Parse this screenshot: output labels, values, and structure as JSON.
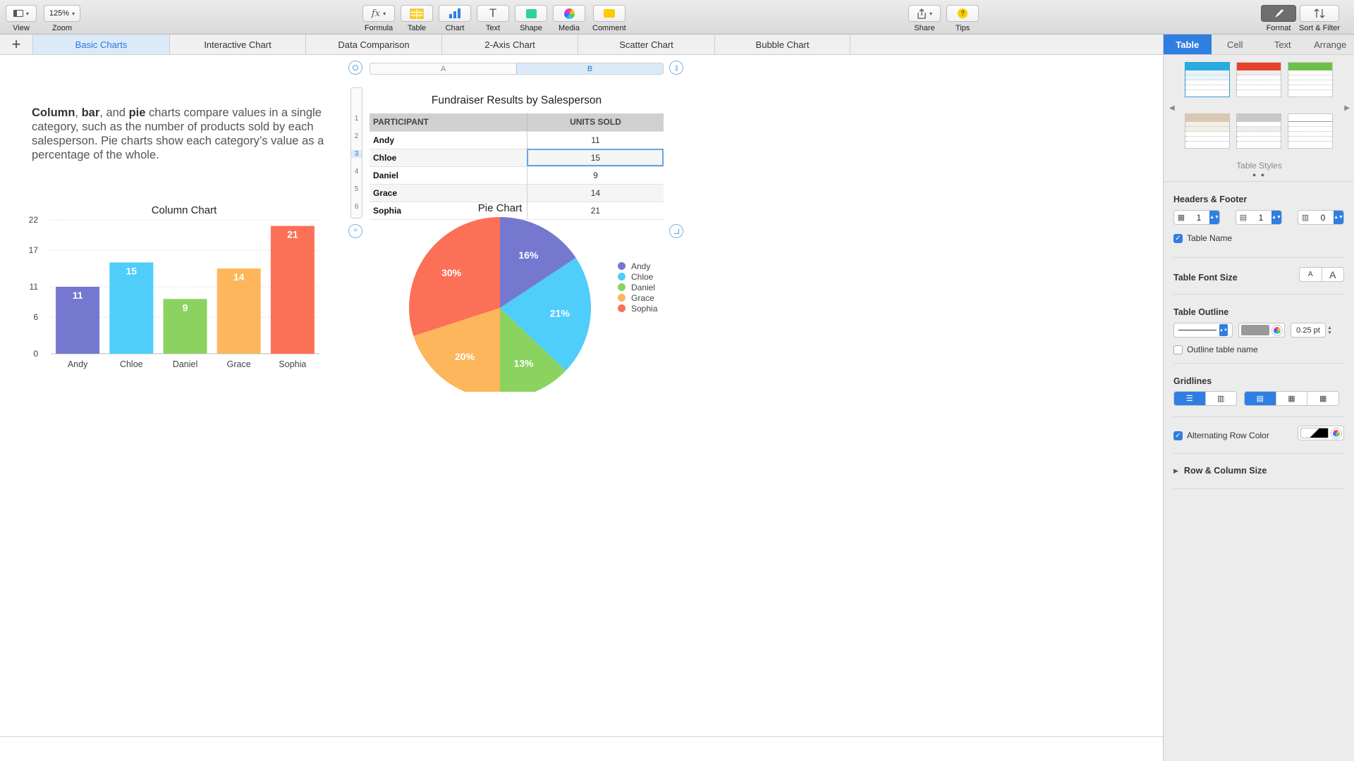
{
  "toolbar": {
    "view": "View",
    "zoom_value": "125%",
    "zoom": "Zoom",
    "formula": "Formula",
    "formula_symbol": "fx",
    "table": "Table",
    "chart": "Chart",
    "text": "Text",
    "text_symbol": "T",
    "shape": "Shape",
    "media": "Media",
    "comment": "Comment",
    "share": "Share",
    "tips": "Tips",
    "tips_symbol": "?",
    "format": "Format",
    "sort_filter": "Sort & Filter"
  },
  "sheets": {
    "add_symbol": "+",
    "tabs": [
      "Basic Charts",
      "Interactive Chart",
      "Data Comparison",
      "2-Axis Chart",
      "Scatter Chart",
      "Bubble Chart"
    ],
    "active_index": 0
  },
  "intro": {
    "bold1": "Column",
    "sep1": ", ",
    "bold2": "bar",
    "sep2": ", and ",
    "bold3": "pie",
    "rest": " charts compare values in a single category, such as the number of products sold by each salesperson. Pie charts show each category’s value as a percentage of the whole."
  },
  "table": {
    "title": "Fundraiser Results by Salesperson",
    "col_letters": [
      "A",
      "B"
    ],
    "row_numbers": [
      "1",
      "2",
      "3",
      "4",
      "5",
      "6"
    ],
    "headers": [
      "PARTICIPANT",
      "UNITS SOLD"
    ],
    "rows": [
      [
        "Andy",
        "11"
      ],
      [
        "Chloe",
        "15"
      ],
      [
        "Daniel",
        "9"
      ],
      [
        "Grace",
        "14"
      ],
      [
        "Sophia",
        "21"
      ]
    ],
    "selected_row": 3
  },
  "chart_data": [
    {
      "type": "bar",
      "title": "Column Chart",
      "categories": [
        "Andy",
        "Chloe",
        "Daniel",
        "Grace",
        "Sophia"
      ],
      "values": [
        11,
        15,
        9,
        14,
        21
      ],
      "colors": [
        "#7478cf",
        "#4fcdfb",
        "#8bd360",
        "#fdb65c",
        "#fc7057"
      ],
      "yticks": [
        0,
        6,
        11,
        17,
        22
      ],
      "ylim": [
        0,
        22
      ],
      "grid": true,
      "data_labels": true
    },
    {
      "type": "pie",
      "title": "Pie Chart",
      "labels": [
        "Andy",
        "Chloe",
        "Daniel",
        "Grace",
        "Sophia"
      ],
      "values": [
        11,
        15,
        9,
        14,
        21
      ],
      "percent_labels": [
        "16%",
        "21%",
        "13%",
        "20%",
        "30%"
      ],
      "colors": [
        "#7478cf",
        "#4fcdfb",
        "#8bd360",
        "#fdb65c",
        "#fc7057"
      ],
      "legend": "right"
    }
  ],
  "inspector": {
    "tabs": [
      "Table",
      "Cell",
      "Text",
      "Arrange"
    ],
    "active_tab": 0,
    "styles_label": "Table Styles",
    "headers_footer": {
      "title": "Headers & Footer",
      "header_rows": "1",
      "header_cols": "1",
      "footer_rows": "0"
    },
    "table_name_label": "Table Name",
    "table_name_checked": true,
    "font_size": {
      "title": "Table Font Size",
      "smaller": "A",
      "larger": "A"
    },
    "outline": {
      "title": "Table Outline",
      "width": "0.25 pt",
      "outline_name_label": "Outline table name",
      "outline_name_checked": false
    },
    "gridlines": {
      "title": "Gridlines"
    },
    "alt_row": {
      "label": "Alternating Row Color",
      "checked": true
    },
    "row_col_size": "Row & Column Size"
  }
}
